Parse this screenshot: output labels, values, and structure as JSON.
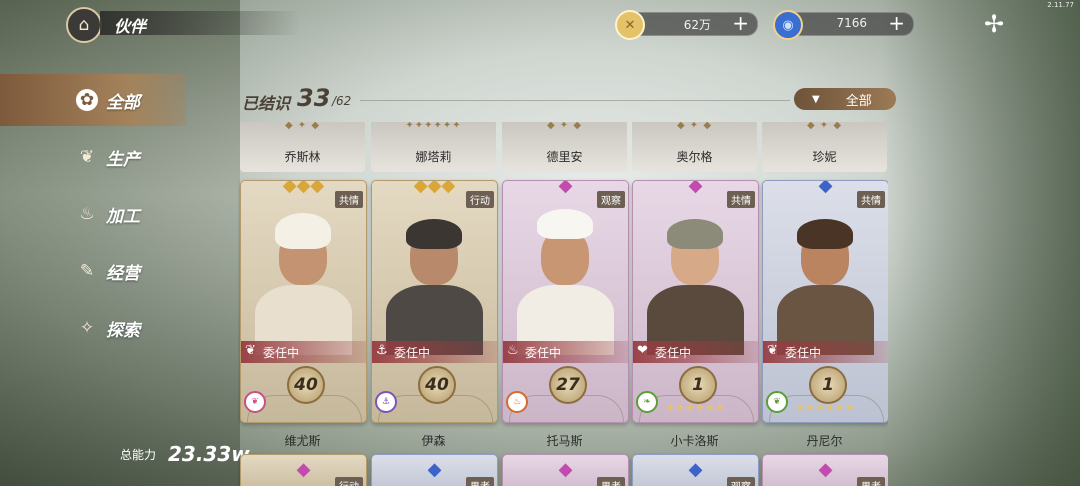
{
  "version": "2.11.77",
  "header": {
    "title": "伙伴",
    "currencies": [
      {
        "name": "gold",
        "value": "62万",
        "icon": "coin-icon",
        "color": "#d4a93b"
      },
      {
        "name": "gem",
        "value": "7166",
        "icon": "gem-icon",
        "color": "#3b6fc6"
      }
    ]
  },
  "nav": {
    "items": [
      {
        "label": "全部",
        "icon": "grid-icon",
        "active": true
      },
      {
        "label": "生产",
        "icon": "wheat-icon"
      },
      {
        "label": "加工",
        "icon": "pot-icon"
      },
      {
        "label": "经营",
        "icon": "tag-icon"
      },
      {
        "label": "探索",
        "icon": "compass-icon"
      }
    ]
  },
  "summary": {
    "known_label": "已结识",
    "known_count": "33",
    "known_total": "/62",
    "filter_label": "全部",
    "total_power_label": "总能力",
    "total_power_value": "23.33w"
  },
  "top_row_names": [
    "乔斯林",
    "娜塔莉",
    "德里安",
    "奥尔格",
    "珍妮"
  ],
  "partners": [
    {
      "name": "维尤斯",
      "tag": "共情",
      "rarity": "gold",
      "status": "委任中",
      "level": "40",
      "skill": "wheat",
      "stars": ""
    },
    {
      "name": "伊森",
      "tag": "行动",
      "rarity": "gold",
      "status": "委任中",
      "level": "40",
      "skill": "anchor",
      "stars": ""
    },
    {
      "name": "托马斯",
      "tag": "观察",
      "rarity": "purple",
      "status": "委任中",
      "level": "27",
      "skill": "pot",
      "stars": ""
    },
    {
      "name": "小卡洛斯",
      "tag": "共情",
      "rarity": "purple",
      "status": "委任中",
      "level": "1",
      "skill": "leaf",
      "stars": "★★★★★★"
    },
    {
      "name": "丹尼尔",
      "tag": "共情",
      "rarity": "blue",
      "status": "委任中",
      "level": "1",
      "skill": "wheat",
      "stars": "★★★★★★"
    }
  ],
  "bottom_row_tags": [
    "行动",
    "果者",
    "果者",
    "观察",
    "果者"
  ]
}
